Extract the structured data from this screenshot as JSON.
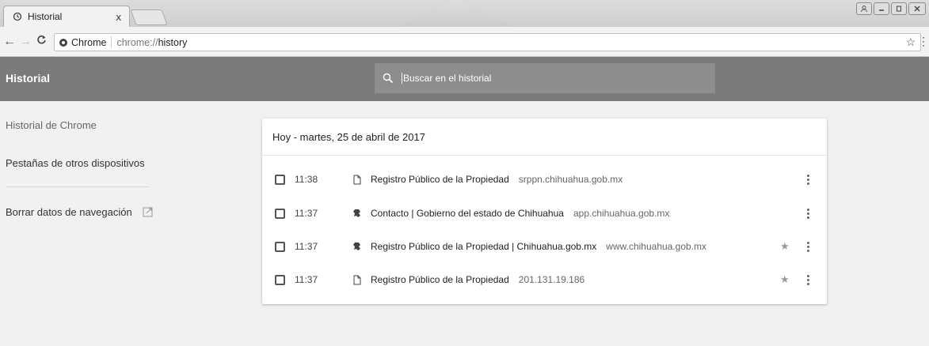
{
  "tab": {
    "title": "Historial",
    "close": "x"
  },
  "window_controls": [
    "person",
    "minimize",
    "restore",
    "close"
  ],
  "omnibox": {
    "chip": "Chrome",
    "url_scheme": "chrome://",
    "url_host": "history"
  },
  "header": {
    "title": "Historial",
    "search_placeholder": "Buscar en el historial"
  },
  "sidebar": {
    "items": [
      {
        "label": "Historial de Chrome"
      },
      {
        "label": "Pestañas de otros dispositivos"
      },
      {
        "label": "Borrar datos de navegación"
      }
    ]
  },
  "history": {
    "date_header": "Hoy - martes, 25 de abril de 2017",
    "entries": [
      {
        "time": "11:38",
        "icon": "page-icon",
        "title": "Registro Público de la Propiedad",
        "domain": "srppn.chihuahua.gob.mx",
        "starred": false
      },
      {
        "time": "11:37",
        "icon": "site-favicon",
        "title": "Contacto | Gobierno del estado de Chihuahua",
        "domain": "app.chihuahua.gob.mx",
        "starred": false
      },
      {
        "time": "11:37",
        "icon": "site-favicon",
        "title": "Registro Público de la Propiedad | Chihuahua.gob.mx",
        "domain": "www.chihuahua.gob.mx",
        "starred": true
      },
      {
        "time": "11:37",
        "icon": "page-icon",
        "title": "Registro Público de la Propiedad",
        "domain": "201.131.19.186",
        "starred": true
      }
    ]
  },
  "colors": {
    "header_bg": "#7b7b7b",
    "search_bg": "#8d8d8d",
    "page_bg": "#f1f1f1"
  }
}
